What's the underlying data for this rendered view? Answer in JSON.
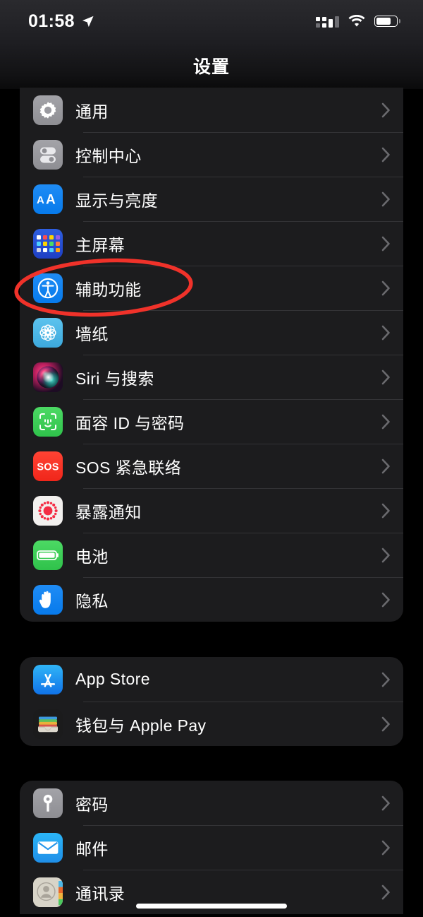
{
  "status_bar": {
    "time": "01:58",
    "location_icon": "location-arrow-icon",
    "signal_icon": "cellular-signal-icon",
    "wifi_icon": "wifi-icon",
    "battery_icon": "battery-icon"
  },
  "nav": {
    "title": "设置"
  },
  "annotation": {
    "type": "ellipse-highlight",
    "color": "#f0322a",
    "target": "辅助功能"
  },
  "colors": {
    "background": "#000000",
    "card": "#1c1c1e",
    "separator": "#333336",
    "label": "#ffffff",
    "chevron": "#6a6a6e",
    "accent_blue": "#0a7aeb",
    "accent_red": "#f0261a",
    "accent_green": "#2fc24b",
    "annotation_red": "#f0322a"
  },
  "sections": [
    {
      "id": "section-system",
      "rows": [
        {
          "label": "通用",
          "icon": "gear-icon",
          "chevron": "chevron-right-icon"
        },
        {
          "label": "控制中心",
          "icon": "toggles-icon",
          "chevron": "chevron-right-icon"
        },
        {
          "label": "显示与亮度",
          "icon": "aa-text-icon",
          "chevron": "chevron-right-icon"
        },
        {
          "label": "主屏幕",
          "icon": "home-screen-grid-icon",
          "chevron": "chevron-right-icon"
        },
        {
          "label": "辅助功能",
          "icon": "accessibility-icon",
          "chevron": "chevron-right-icon",
          "highlighted": true
        },
        {
          "label": "墙纸",
          "icon": "wallpaper-flower-icon",
          "chevron": "chevron-right-icon"
        },
        {
          "label": "Siri 与搜索",
          "icon": "siri-orb-icon",
          "chevron": "chevron-right-icon"
        },
        {
          "label": "面容 ID 与密码",
          "icon": "face-id-icon",
          "chevron": "chevron-right-icon"
        },
        {
          "label": "SOS 紧急联络",
          "icon": "sos-icon",
          "chevron": "chevron-right-icon"
        },
        {
          "label": "暴露通知",
          "icon": "exposure-notification-icon",
          "chevron": "chevron-right-icon"
        },
        {
          "label": "电池",
          "icon": "battery-green-icon",
          "chevron": "chevron-right-icon"
        },
        {
          "label": "隐私",
          "icon": "privacy-hand-icon",
          "chevron": "chevron-right-icon"
        }
      ]
    },
    {
      "id": "section-store",
      "rows": [
        {
          "label": "App Store",
          "icon": "app-store-icon",
          "chevron": "chevron-right-icon"
        },
        {
          "label": "钱包与 Apple Pay",
          "icon": "wallet-icon",
          "chevron": "chevron-right-icon"
        }
      ]
    },
    {
      "id": "section-accounts",
      "rows": [
        {
          "label": "密码",
          "icon": "key-icon",
          "chevron": "chevron-right-icon"
        },
        {
          "label": "邮件",
          "icon": "mail-icon",
          "chevron": "chevron-right-icon"
        },
        {
          "label": "通讯录",
          "icon": "contacts-icon",
          "chevron": "chevron-right-icon"
        }
      ]
    }
  ],
  "home_indicator": "home-indicator"
}
